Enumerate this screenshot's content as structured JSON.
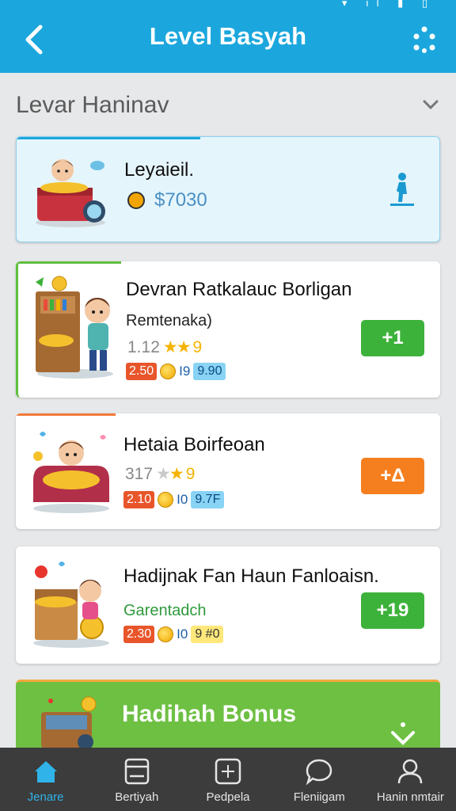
{
  "header": {
    "title": "Level Basyah",
    "back_icon": "chevron-left-icon",
    "menu_icon": "dots-grid-icon",
    "status_icons": "▾ ıl ▮ ▯"
  },
  "section": {
    "title": "Levar Haninav",
    "chevron_icon": "chevron-down-icon"
  },
  "cards": [
    {
      "title": "Leyaieil.",
      "price": "$7030",
      "illustration": "child-with-treasure-chest",
      "action_icon": "walking-person-icon"
    },
    {
      "title": "Devran Ratkalauc Borligan",
      "subtitle": "Remtenaka)",
      "rating": "1.12",
      "rating_suffix": "9",
      "tag_orange": "2.50",
      "tag_plain": "I9",
      "tag_badge": "9.90",
      "action_label": "+1",
      "illustration": "child-at-shop-shelf"
    },
    {
      "title": "Hetaia Boirfeoan",
      "rating": "317",
      "rating_suffix": "9",
      "tag_orange": "2.10",
      "tag_plain": "I0",
      "tag_badge": "9.7F",
      "action_label": "+Δ",
      "illustration": "child-in-coin-sofa"
    },
    {
      "title": "Hadijnak Fan Haun Fanloaisn.",
      "subtitle": "Garentadch",
      "tag_orange": "2.30",
      "tag_plain": "I0",
      "tag_badge": "9 #0",
      "action_label": "+19",
      "illustration": "child-with-coin-box"
    }
  ],
  "bonus": {
    "title": "Hadihah Bonus",
    "chevron_icon": "chevron-down-icon"
  },
  "nav": [
    {
      "label": "Jenare",
      "icon": "home-icon",
      "active": true
    },
    {
      "label": "Bertiyah",
      "icon": "card-icon",
      "active": false
    },
    {
      "label": "Pedpela",
      "icon": "gift-box-icon",
      "active": false
    },
    {
      "label": "Fleniigam",
      "icon": "chat-bubble-icon",
      "active": false
    },
    {
      "label": "Hanin nmtair",
      "icon": "profile-icon",
      "active": false
    }
  ],
  "colors": {
    "header_bg": "#1ba7dd",
    "green": "#3db23b",
    "orange": "#f57f1f",
    "nav_bg": "#3c3c3c",
    "nav_active": "#2fb3e8"
  }
}
